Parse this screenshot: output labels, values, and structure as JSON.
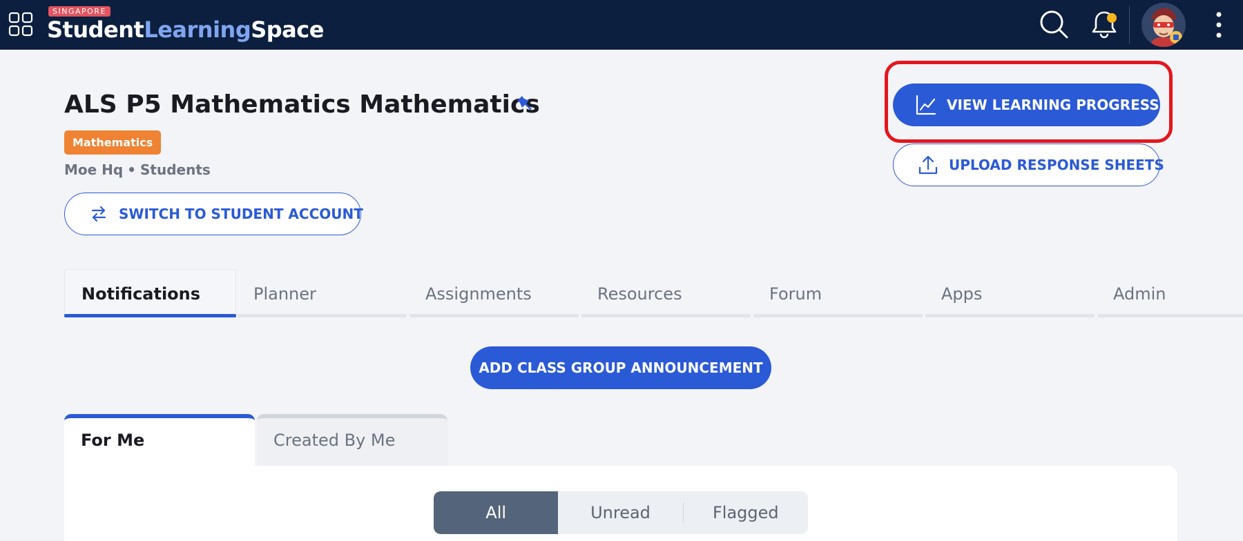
{
  "app": {
    "logo_tag": "SINGAPORE",
    "logo_word1": "Student",
    "logo_word2": "Learning",
    "logo_word3": "Space",
    "brand_colors": {
      "topbar": "#0c1f3f",
      "primary": "#2b5ad6",
      "badge": "#f08233",
      "notification_dot": "#f6b61c",
      "highlight": "#e5161c"
    }
  },
  "topbar_icons": [
    "apps-grid-icon",
    "search-icon",
    "bell-icon",
    "avatar",
    "more-vertical-icon"
  ],
  "header": {
    "title": "ALS P5 Mathematics Mathematics",
    "subject_badge": "Mathematics",
    "meta_org": "Moe Hq",
    "meta_separator": "•",
    "meta_role": "Students",
    "switch_account_label": "SWITCH TO STUDENT ACCOUNT",
    "view_progress_label": "VIEW LEARNING PROGRESS",
    "upload_sheets_label": "UPLOAD RESPONSE SHEETS"
  },
  "main_tabs": [
    {
      "label": "Notifications",
      "active": true
    },
    {
      "label": "Planner"
    },
    {
      "label": "Assignments"
    },
    {
      "label": "Resources"
    },
    {
      "label": "Forum"
    },
    {
      "label": "Apps"
    },
    {
      "label": "Admin"
    }
  ],
  "announce_label": "ADD CLASS GROUP ANNOUNCEMENT",
  "sub_tabs": [
    {
      "label": "For Me",
      "active": true
    },
    {
      "label": "Created By Me"
    }
  ],
  "filter": {
    "options": [
      "All",
      "Unread",
      "Flagged"
    ],
    "selected": "All"
  }
}
